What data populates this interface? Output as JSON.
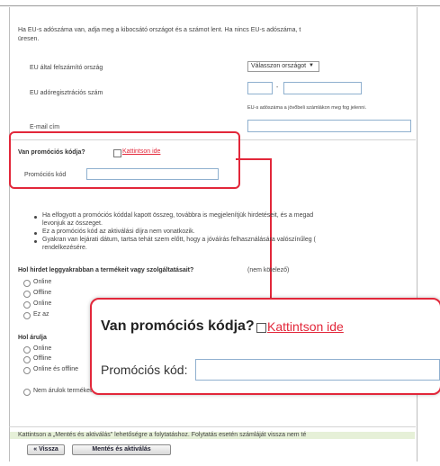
{
  "intro": {
    "line1": "Ha EU-s adószáma van, adja meg a kibocsátó országot és a számot lent. Ha nincs EU-s adószáma, t",
    "line2": "üresen."
  },
  "form": {
    "country_label": "EU által felszámító ország",
    "country_select": "Válasszon országot",
    "tax_label": "EU adóregisztrációs szám",
    "tax_dash": "-",
    "tax_hint": "EU-s adószáma a jövőbeli számlákon meg fog jelenni.",
    "email_label": "E-mail cím"
  },
  "promo": {
    "question": "Van promóciós kódja?",
    "link": "Kattintson ide",
    "code_label": "Promóciós kód"
  },
  "bullets": [
    {
      "line1": "Ha elfogyott a promóciós kóddal kapott összeg, továbbra is megjelenítjük hirdetéseit, és a megad",
      "line2": "levonjuk az összeget."
    },
    {
      "line1": "Ez a promóciós kód az aktiválási díjra nem vonatkozik.",
      "line2": ""
    },
    {
      "line1": "Gyakran van lejárati dátum, tartsa tehát szem előtt, hogy a jóváírás felhasználására valószínűleg (",
      "line2": "rendelkezésére."
    }
  ],
  "survey1": {
    "question": "Hol hirdet leggyakrabban a termékeit vagy szolgáltatásait?",
    "note": "(nem kötelező)",
    "options": [
      "Online",
      "Offline",
      "Online",
      "Ez az"
    ]
  },
  "survey2": {
    "question": "Hol árulja",
    "options": [
      "Online",
      "Offline",
      "Online és offline",
      "Nem árulok terméket vagy szolgáltatást."
    ]
  },
  "footer": {
    "text": "Kattintson a „Mentés és aktiválás\" lehetőségre a folytatáshoz. Folytatás esetén számláját vissza nem té",
    "back_button": "« Vissza",
    "save_button": "Mentés és aktiválás"
  },
  "callout": {
    "question": "Van promóciós kódja?",
    "link": "Kattintson ide",
    "code_label": "Promóciós kód:"
  },
  "colors": {
    "highlight": "#e2273a",
    "link": "#e2273a",
    "input_border": "#8fb0cf"
  }
}
